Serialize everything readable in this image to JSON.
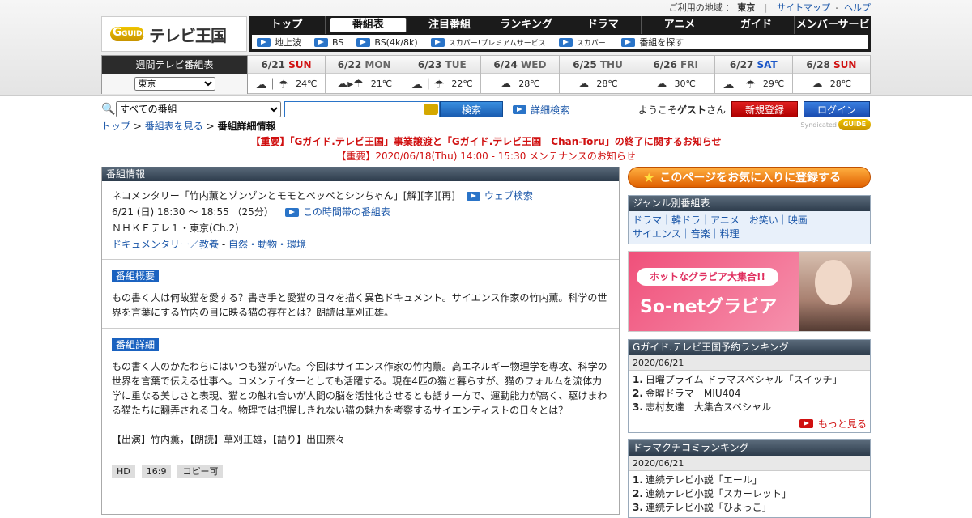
{
  "topbar": {
    "area_label": "ご利用の地域 ：",
    "area": "東京",
    "sitemap": "サイトマップ",
    "dash": "-",
    "help": "ヘルプ"
  },
  "logo": {
    "badge": "GUIDE",
    "title": "テレビ王国"
  },
  "nav": {
    "main": [
      "トップ",
      "番組表",
      "注目番組",
      "ランキング",
      "ドラマ",
      "アニメ",
      "ガイド",
      "メンバーサービス"
    ],
    "active": "番組表",
    "sub": [
      "地上波",
      "BS",
      "BS(4k/8k)",
      "スカパー!プレミアムサービス",
      "スカパー!",
      "番組を探す"
    ]
  },
  "week": {
    "label": "週間テレビ番組表",
    "region": "東京",
    "days": [
      {
        "date": "6/21",
        "wd": "SUN",
        "type": "sun",
        "temp": "24℃",
        "weather": "☁｜☂"
      },
      {
        "date": "6/22",
        "wd": "MON",
        "type": "wd",
        "temp": "21℃",
        "weather": "☁▸☂"
      },
      {
        "date": "6/23",
        "wd": "TUE",
        "type": "wd",
        "temp": "22℃",
        "weather": "☁｜☂"
      },
      {
        "date": "6/24",
        "wd": "WED",
        "type": "wd",
        "temp": "28℃",
        "weather": "☁"
      },
      {
        "date": "6/25",
        "wd": "THU",
        "type": "wd",
        "temp": "28℃",
        "weather": "☁"
      },
      {
        "date": "6/26",
        "wd": "FRI",
        "type": "wd",
        "temp": "30℃",
        "weather": "☁"
      },
      {
        "date": "6/27",
        "wd": "SAT",
        "type": "sat",
        "temp": "29℃",
        "weather": "☁｜☂"
      },
      {
        "date": "6/28",
        "wd": "SUN",
        "type": "sun",
        "temp": "28℃",
        "weather": "☁"
      }
    ]
  },
  "search": {
    "category": "すべての番組",
    "button": "検索",
    "advanced": "詳細検索"
  },
  "user": {
    "welcome_pre": "ようこそ",
    "name": "ゲスト",
    "welcome_post": "さん",
    "register": "新規登録",
    "login": "ログイン"
  },
  "breadcrumb": {
    "top": "トップ",
    "sep": ">",
    "list": "番組表を見る",
    "current": "番組詳細情報"
  },
  "syndicated": {
    "label": "Syndicated",
    "badge": "GUIDE"
  },
  "notice": {
    "n1": "【重要】「Gガイド.テレビ王国」事業譲渡と「Gガイド.テレビ王国　Chan-Toru」の終了に関するお知らせ",
    "n2": "【重要】2020/06/18(Thu) 14:00 - 15:30 メンテナンスのお知らせ"
  },
  "program": {
    "section": "番組情報",
    "title": "ネコメンタリー「竹内薫とゾンゾンとモモとペッペとシンちゃん」[解][字][再]",
    "web_search": "ウェブ検索",
    "time": "6/21 (日) 18:30 ～ 18:55 （25分）",
    "time_link": "この時間帯の番組表",
    "channel": "ＮＨＫＥテレ１・東京(Ch.2)",
    "genre_a": "ドキュメンタリー／教養",
    "genre_sep": " - ",
    "genre_b": "自然・動物・環境",
    "summary_label": "番組概要",
    "summary": "もの書く人は何故猫を愛する？書き手と愛猫の日々を描く異色ドキュメント。サイエンス作家の竹内薫。科学の世界を言葉にする竹内の目に映る猫の存在とは？朗読は草刈正雄。",
    "detail_label": "番組詳細",
    "detail": "もの書く人のかたわらにはいつも猫がいた。今回はサイエンス作家の竹内薫。高エネルギー物理学を専攻、科学の世界を言葉で伝える仕事へ。コメンテイターとしても活躍する。現在4匹の猫と暮らすが、猫のフォルムを流体力学に重なる美しさと表現、猫との触れ合いが人間の脳を活性化させるとも話す一方で、運動能力が高く、駆けまわる猫たちに翻弄される日々。物理では把握しきれない猫の魅力を考察するサイエンティストの日々とは？",
    "cast": "【出演】竹内薫，【朗読】草刈正雄，【語り】出田奈々",
    "chips": [
      "HD",
      "16:9",
      "コピー可"
    ]
  },
  "side": {
    "favorite": "このページをお気に入りに登録する",
    "genre_title": "ジャンル別番組表",
    "genres_line1": "ドラマ｜韓ドラ｜アニメ｜お笑い｜映画｜",
    "genres_line2": "サイエンス｜音楽｜料理｜",
    "ad_tag": "ホットなグラビア大集合!!",
    "ad_title": "So-netグラビア",
    "rank1_title": "Gガイド.テレビ王国予約ランキング",
    "rank1_date": "2020/06/21",
    "rank1": [
      "日曜プライム ドラマスペシャル「スイッチ」",
      "金曜ドラマ　MIU404",
      "志村友達　大集合スペシャル"
    ],
    "more": "もっと見る",
    "rank2_title": "ドラマクチコミランキング",
    "rank2_date": "2020/06/21",
    "rank2": [
      "連続テレビ小説「エール」",
      "連続テレビ小説「スカーレット」",
      "連続テレビ小説「ひよっこ」"
    ]
  }
}
